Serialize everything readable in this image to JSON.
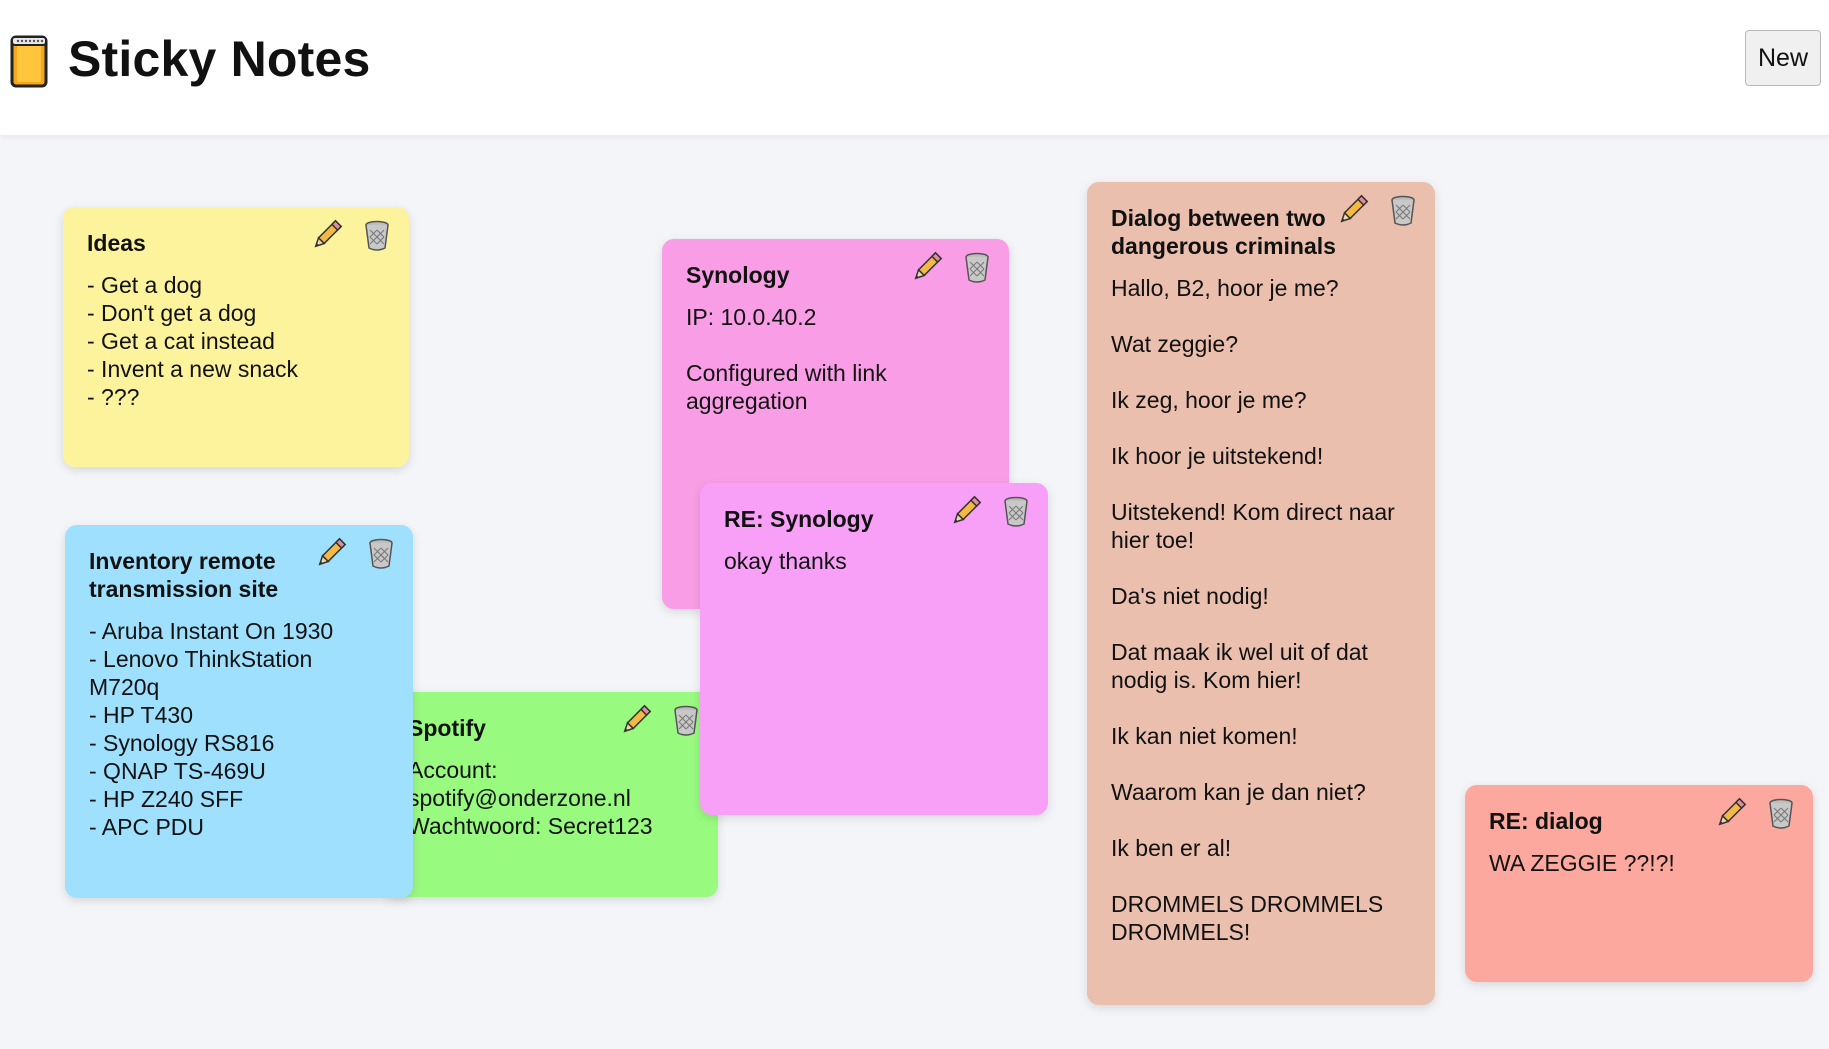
{
  "app": {
    "title": "Sticky Notes",
    "logo_icon": "notepad-icon",
    "new_button_label": "New"
  },
  "colors": {
    "yellow": "#fdf39c",
    "blue": "#9ee0fd",
    "green": "#99fa80",
    "pink": "#f99ee6",
    "violet": "#f8a0f8",
    "tan": "#eabfae",
    "salmon": "#fca89e"
  },
  "notes": [
    {
      "title": "Ideas",
      "body": "- Get a dog\n- Don't get a dog\n- Get a cat instead\n- Invent a new snack\n- ???",
      "color": "yellow"
    },
    {
      "title": "Spotify",
      "body": "Account:\nspotify@onderzone.nl\nWachtwoord: Secret123",
      "color": "green"
    },
    {
      "title": "Inventory remote transmission site",
      "body": "- Aruba Instant On 1930\n- Lenovo ThinkStation M720q\n- HP T430\n- Synology RS816\n- QNAP TS-469U\n- HP Z240 SFF\n- APC PDU",
      "color": "blue"
    },
    {
      "title": "Synology",
      "body": "IP: 10.0.40.2\n\nConfigured with link aggregation",
      "color": "pink"
    },
    {
      "title": "RE: Synology",
      "body": "okay thanks",
      "color": "violet"
    },
    {
      "title": "Dialog between two dangerous criminals",
      "body": "Hallo, B2, hoor je me?\n\nWat zeggie?\n\nIk zeg, hoor je me?\n\nIk hoor je uitstekend!\n\nUitstekend! Kom direct naar hier toe!\n\nDa's niet nodig!\n\nDat maak ik wel uit of dat nodig is. Kom hier!\n\nIk kan niet komen!\n\nWaarom kan je dan niet?\n\nIk ben er al!\n\nDROMMELS DROMMELS DROMMELS!",
      "color": "tan"
    },
    {
      "title": "RE: dialog",
      "body": "WA ZEGGIE ??!?!",
      "color": "salmon"
    }
  ],
  "note_actions": {
    "edit_icon": "pencil-icon",
    "delete_icon": "trash-icon"
  }
}
